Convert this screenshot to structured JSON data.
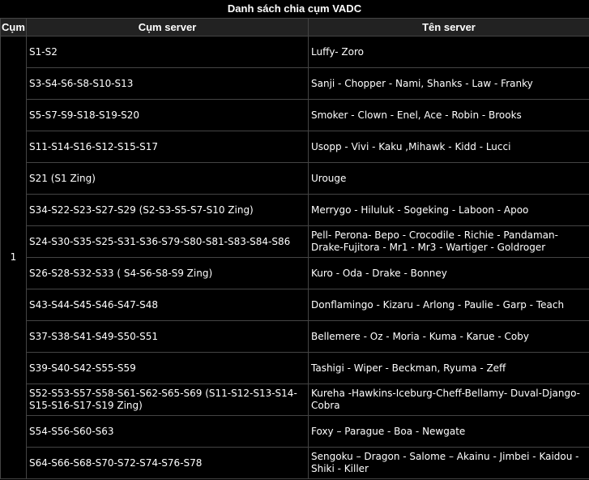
{
  "title": "Danh sách chia cụm VADC",
  "headers": {
    "cluster": "Cụm",
    "servers": "Cụm server",
    "names": "Tên server"
  },
  "cluster_value": "1",
  "rows": [
    {
      "servers": "S1-S2",
      "names": "Luffy- Zoro"
    },
    {
      "servers": "S3-S4-S6-S8-S10-S13",
      "names": "Sanji - Chopper - Nami, Shanks - Law - Franky"
    },
    {
      "servers": "S5-S7-S9-S18-S19-S20",
      "names": "Smoker - Clown - Enel, Ace - Robin - Brooks"
    },
    {
      "servers": "S11-S14-S16-S12-S15-S17",
      "names": "Usopp - Vivi - Kaku ,Mihawk - Kidd - Lucci"
    },
    {
      "servers": "S21 (S1 Zing)",
      "names": "Urouge"
    },
    {
      "servers": "S34-S22-S23-S27-S29 (S2-S3-S5-S7-S10 Zing)",
      "names": "Merrygo  - Hiluluk - Sogeking - Laboon - Apoo"
    },
    {
      "servers": "S24-S30-S35-S25-S31-S36-S79-S80-S81-S83-S84-S86",
      "names": "Pell- Perona- Bepo - Crocodile - Richie - Pandaman-Drake-Fujitora - Mr1 - Mr3 - Wartiger - Goldroger"
    },
    {
      "servers": "S26-S28-S32-S33 ( S4-S6-S8-S9 Zing)",
      "names": "Kuro - Oda - Drake - Bonney"
    },
    {
      "servers": "S43-S44-S45-S46-S47-S48",
      "names": "Donflamingo - Kizaru - Arlong - Paulie - Garp - Teach"
    },
    {
      "servers": "S37-S38-S41-S49-S50-S51",
      "names": "Bellemere - Oz - Moria - Kuma - Karue - Coby"
    },
    {
      "servers": "S39-S40-S42-S55-S59",
      "names": "Tashigi - Wiper  - Beckman, Ryuma - Zeff"
    },
    {
      "servers": "S52-S53-S57-S58-S61-S62-S65-S69 (S11-S12-S13-S14-S15-S16-S17-S19 Zing)",
      "names": "Kureha -Hawkins-Iceburg-Cheff-Bellamy- Duval-Django-Cobra"
    },
    {
      "servers": "S54-S56-S60-S63",
      "names": "Foxy – Parague - Boa - Newgate"
    },
    {
      "servers": "S64-S66-S68-S70-S72-S74-S76-S78",
      "names": "Sengoku – Dragon - Salome – Akainu - Jimbei - Kaidou - Shiki - Killer"
    }
  ]
}
